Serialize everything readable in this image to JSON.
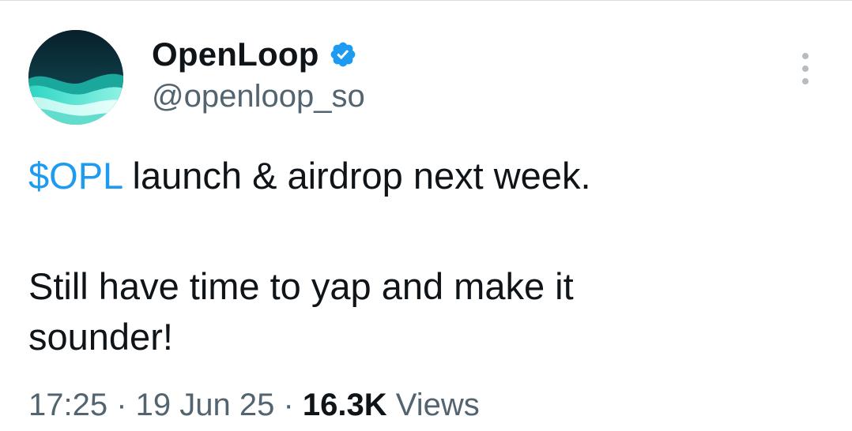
{
  "author": {
    "display_name": "OpenLoop",
    "handle": "@openloop_so",
    "verified": true,
    "avatar_icon": "openloop-wave-logo"
  },
  "tweet": {
    "cashtag": "$OPL",
    "line1_rest": " launch & airdrop next week.",
    "line2": "Still have time to yap and make it",
    "line3": "sounder!"
  },
  "meta": {
    "time": "17:25",
    "separator": " · ",
    "date": "19 Jun 25",
    "views_count": "16.3K",
    "views_label": " Views"
  },
  "colors": {
    "text": "#0f1419",
    "secondary": "#536471",
    "link": "#1d9bf0",
    "verified": "#1d9bf0"
  },
  "icons": {
    "more": "more-vertical-icon",
    "verified": "verified-badge-icon"
  }
}
